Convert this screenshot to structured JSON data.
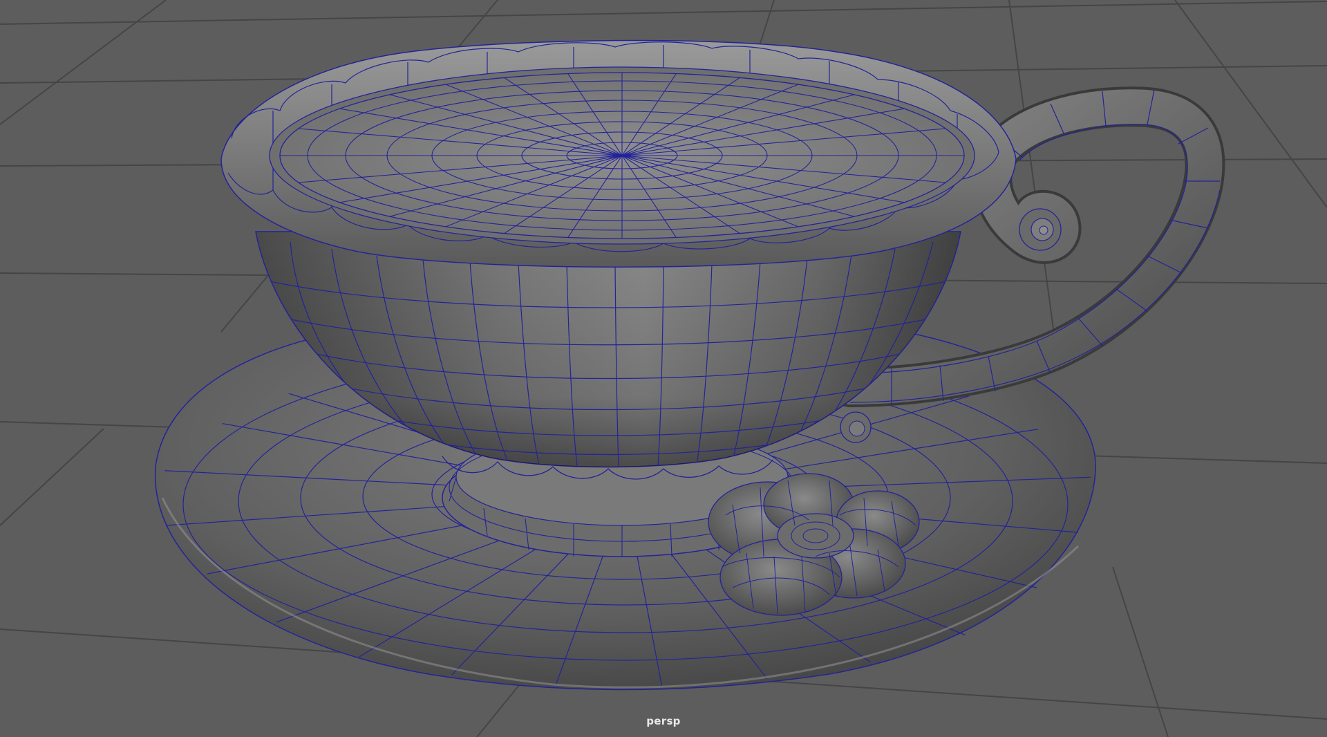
{
  "viewport": {
    "camera_name": "persp",
    "display_mode": "smooth-shade-with-wireframe",
    "colors": {
      "background": "#5d5d5d",
      "grid_line": "#454545",
      "wire": "#23239a",
      "surface_light": "#8a8a8a",
      "surface_dark": "#3c3c3c"
    }
  },
  "scene": {
    "objects": [
      "teacup",
      "cup-handle",
      "saucer",
      "cup-foot",
      "flower-ornament"
    ]
  }
}
